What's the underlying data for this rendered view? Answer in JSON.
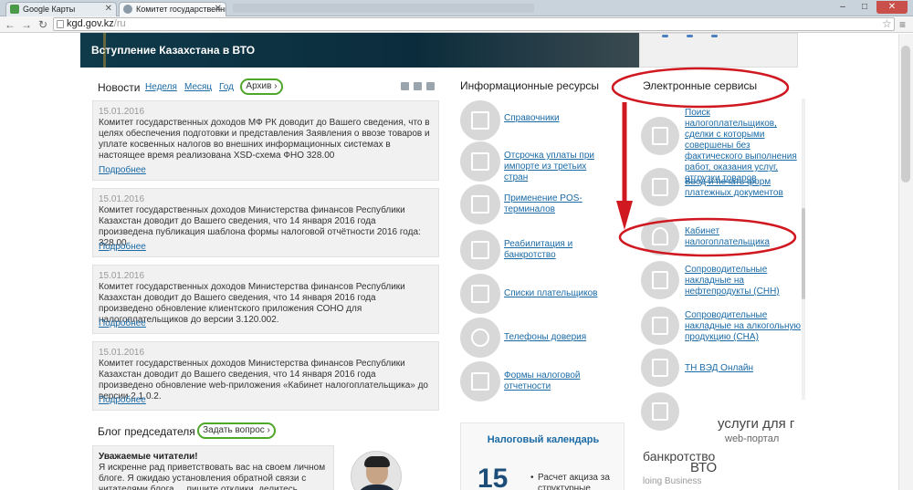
{
  "browser": {
    "tabs": [
      {
        "title": "Google Карты"
      },
      {
        "title": "Комитет государственны"
      }
    ],
    "url_domain": "kgd.gov.kz",
    "url_path": "/ru",
    "min": "–",
    "max": "□",
    "close": "✕"
  },
  "banner": {
    "title": "Вступление Казахстана в ВТО"
  },
  "news": {
    "heading": "Новости",
    "tabs": [
      "Неделя",
      "Месяц",
      "Год"
    ],
    "archive": "Архив",
    "more_label": "Подробнее",
    "items": [
      {
        "date": "15.01.2016",
        "text": "Комитет государственных доходов МФ РК доводит до Вашего сведения, что в целях обеспечения подготовки и представления Заявления о ввозе товаров и уплате косвенных налогов во внешних информационных системах в настоящее время реализована XSD-схема ФНО 328.00"
      },
      {
        "date": "15.01.2016",
        "text": "Комитет государственных доходов Министерства финансов Республики Казахстан доводит до Вашего сведения, что 14 января 2016 года произведена публикация шаблона формы налоговой отчётности 2016 года: 328.00"
      },
      {
        "date": "15.01.2016",
        "text": "Комитет государственных доходов Министерства финансов Республики Казахстан доводит до Вашего сведения, что 14 января 2016 года произведено обновление клиентского приложения СОНО для налогоплательщиков до версии 3.120.002."
      },
      {
        "date": "15.01.2016",
        "text": "Комитет государственных доходов Министерства финансов Республики Казахстан доводит до Вашего сведения, что 14 января 2016 года произведено обновление web-приложения «Кабинет налогоплательщика» до версии 2.1.0.2."
      }
    ]
  },
  "blog": {
    "title": "Блог председателя",
    "ask": "Задать вопрос",
    "greeting": "Уважаемые читатели!",
    "body": "Я искренне рад приветствовать вас на своем личном блоге. Я ожидаю установления обратной связи с читателями блога ... пишите отклики, делитесь мнениями, вносите"
  },
  "info": {
    "heading": "Информационные ресурсы",
    "items": [
      {
        "label": "Справочники",
        "icon": "binders-icon"
      },
      {
        "label": "Отсрочка уплаты при импорте из третьих стран",
        "icon": "binders-icon"
      },
      {
        "label": "Применение POS-терминалов",
        "icon": "pos-terminal-icon"
      },
      {
        "label": "Реабилитация и банкротство",
        "icon": "chart-icon"
      },
      {
        "label": "Списки плательщиков",
        "icon": "documents-icon"
      },
      {
        "label": "Телефоны доверия",
        "icon": "phone-icon"
      },
      {
        "label": "Формы налоговой отчетности",
        "icon": "binders-icon"
      }
    ]
  },
  "calendar": {
    "title": "Налоговый календарь",
    "day": "15",
    "item": "Расчет акциза за структурные"
  },
  "eservices": {
    "heading": "Электронные сервисы",
    "items": [
      {
        "label": "Поиск налогоплательщиков, сделки с которыми совершены без фактического выполнения работ, оказания услуг, отгрузки товаров",
        "icon": "search-document-icon"
      },
      {
        "label": "Ввод и печать форм платежных документов",
        "icon": "printer-icon"
      },
      {
        "label": "Кабинет налогоплательщика",
        "icon": "user-icon"
      },
      {
        "label": "Сопроводительные накладные на нефтепродукты (СНН)",
        "icon": "oil-pump-icon"
      },
      {
        "label": "Сопроводительные накладные на алкогольную продукцию (СНА)",
        "icon": "bottle-icon"
      },
      {
        "label": "ТН ВЭД Онлайн",
        "icon": "binders-icon"
      }
    ]
  },
  "promo": {
    "services": "услуги для г",
    "portal": "web-портал",
    "bankruptcy": "банкротство",
    "wto": "ВТО",
    "doing": "loing Business"
  },
  "colors": {
    "accent": "#1a6aa6",
    "green": "#4ea72a",
    "annotation": "#d01820"
  }
}
